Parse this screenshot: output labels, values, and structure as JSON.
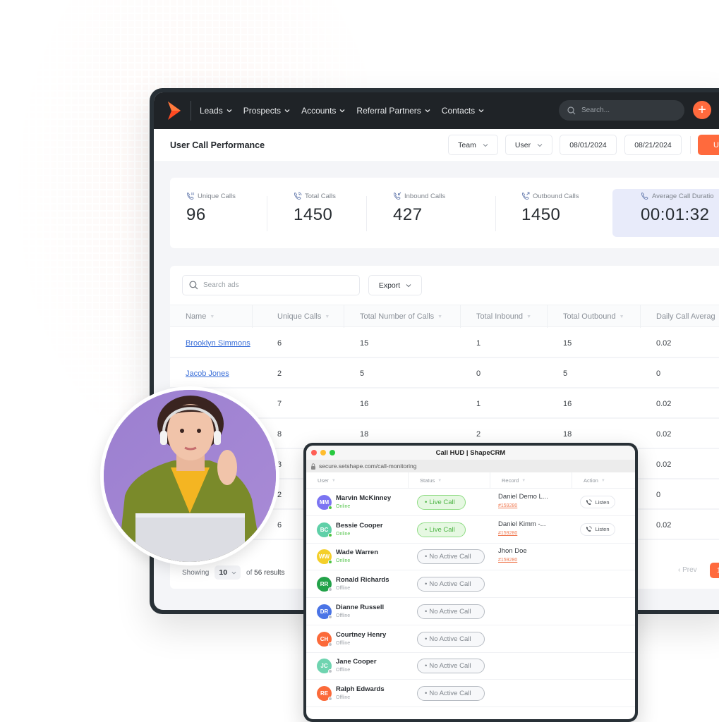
{
  "nav": {
    "items": [
      {
        "label": "Leads"
      },
      {
        "label": "Prospects"
      },
      {
        "label": "Accounts"
      },
      {
        "label": "Referral Partners"
      },
      {
        "label": "Contacts"
      }
    ],
    "search_placeholder": "Search...",
    "add_icon": "plus-icon"
  },
  "pagebar": {
    "title": "User Call Performance",
    "team_label": "Team",
    "user_label": "User",
    "date_from": "08/01/2024",
    "date_to": "08/21/2024",
    "action_label_partial": "U"
  },
  "stats": [
    {
      "label": "Unique Calls",
      "value": "96",
      "icon": "phone-dots-icon"
    },
    {
      "label": "Total Calls",
      "value": "1450",
      "icon": "phone-ring-icon"
    },
    {
      "label": "Inbound Calls",
      "value": "427",
      "icon": "phone-incoming-icon"
    },
    {
      "label": "Outbound Calls",
      "value": "1450",
      "icon": "phone-outgoing-icon"
    },
    {
      "label": "Average Call Duratio",
      "value": "00:01:32",
      "icon": "phone-icon"
    }
  ],
  "table": {
    "search_placeholder": "Search ads",
    "export_label": "Export",
    "columns": [
      "Name",
      "Unique Calls",
      "Total Number of Calls",
      "Total Inbound",
      "Total Outbound",
      "Daily Call Averag"
    ],
    "rows": [
      {
        "name": "Brooklyn Simmons",
        "unique": "6",
        "total": "15",
        "inbound": "1",
        "outbound": "15",
        "daily": "0.02"
      },
      {
        "name": "Jacob Jones",
        "unique": "2",
        "total": "5",
        "inbound": "0",
        "outbound": "5",
        "daily": "0"
      },
      {
        "name": "",
        "unique": "7",
        "total": "16",
        "inbound": "1",
        "outbound": "16",
        "daily": "0.02"
      },
      {
        "name": "",
        "unique": "8",
        "total": "18",
        "inbound": "2",
        "outbound": "18",
        "daily": "0.02"
      },
      {
        "name": "",
        "unique": "3",
        "total": "",
        "inbound": "",
        "outbound": "",
        "daily": "0.02"
      },
      {
        "name": "",
        "unique": "2",
        "total": "",
        "inbound": "",
        "outbound": "",
        "daily": "0"
      },
      {
        "name": "",
        "unique": "6",
        "total": "",
        "inbound": "",
        "outbound": "",
        "daily": "0.02"
      }
    ],
    "footer": {
      "showing_label": "Showing",
      "per_page": "10",
      "results_prefix": "of",
      "results_count": "56 results",
      "prev_label": "Prev",
      "current_page": "1"
    }
  },
  "hud": {
    "title": "Call HUD | ShapeCRM",
    "url": "secure.setshape.com/call-monitoring",
    "columns": [
      "User",
      "Status",
      "Record",
      "Action"
    ],
    "rows": [
      {
        "initials": "MM",
        "name": "Marvin McKinney",
        "presence": "Online",
        "color": "#7b74f2",
        "status": "Live Call",
        "live": true,
        "record": "Daniel Demo L...",
        "record_id": "#159280",
        "action": "Listen"
      },
      {
        "initials": "BC",
        "name": "Bessie Cooper",
        "presence": "Online",
        "color": "#5fd0a8",
        "status": "Live Call",
        "live": true,
        "record": "Daniel Kimm -...",
        "record_id": "#159280",
        "action": "Listen"
      },
      {
        "initials": "WW",
        "name": "Wade Warren",
        "presence": "Online",
        "color": "#f4cf2a",
        "status": "No Active Call",
        "live": false,
        "record": "Jhon Doe",
        "record_id": "#159280",
        "action": ""
      },
      {
        "initials": "RR",
        "name": "Ronald Richards",
        "presence": "Offline",
        "color": "#23a24a",
        "status": "No Active Call",
        "live": false,
        "record": "",
        "record_id": "",
        "action": ""
      },
      {
        "initials": "DR",
        "name": "Dianne Russell",
        "presence": "Offline",
        "color": "#4a74e6",
        "status": "No Active Call",
        "live": false,
        "record": "",
        "record_id": "",
        "action": ""
      },
      {
        "initials": "CH",
        "name": "Courtney Henry",
        "presence": "Offline",
        "color": "#fb6a3a",
        "status": "No Active Call",
        "live": false,
        "record": "",
        "record_id": "",
        "action": ""
      },
      {
        "initials": "JC",
        "name": "Jane Cooper",
        "presence": "Offline",
        "color": "#6fd4b0",
        "status": "No Active Call",
        "live": false,
        "record": "",
        "record_id": "",
        "action": ""
      },
      {
        "initials": "RE",
        "name": "Ralph Edwards",
        "presence": "Offline",
        "color": "#fb6a3a",
        "status": "No Active Call",
        "live": false,
        "record": "",
        "record_id": "",
        "action": ""
      }
    ]
  },
  "colors": {
    "accent": "#ff6a3d",
    "nav_bg": "#1f2327",
    "link": "#3a6fd8",
    "online": "#4cc33f",
    "offline": "#bfc3c8"
  }
}
